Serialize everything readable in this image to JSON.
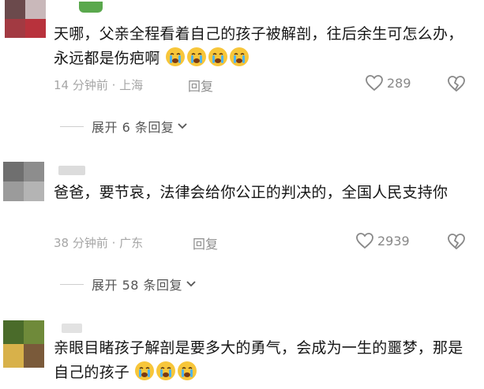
{
  "comments": [
    {
      "text": "天哪，父亲全程看着自己的孩子被解剖，往后余生可怎么办，永远都是伤疤啊",
      "emoji_count": 4,
      "meta": "14 分钟前 · 上海",
      "reply_label": "回复",
      "likes": "289",
      "expand_label": "展开 6 条回复"
    },
    {
      "text": "爸爸，要节哀，法律会给你公正的判决的，全国人民支持你",
      "emoji_count": 0,
      "meta": "38 分钟前 · 广东",
      "reply_label": "回复",
      "likes": "2939",
      "expand_label": "展开 58 条回复"
    },
    {
      "text": "亲眼目睹孩子解剖是要多大的勇气，会成为一生的噩梦，那是自己的孩子",
      "emoji_count": 3
    }
  ],
  "icons": {
    "like": "heart-outline-icon",
    "dislike": "broken-heart-icon",
    "expand": "chevron-down-icon",
    "emoji": "crying-face-emoji"
  },
  "colors": {
    "emoji_face": "#f7c63a",
    "tear": "#4fb3f0",
    "meta": "#a6a6a6"
  }
}
